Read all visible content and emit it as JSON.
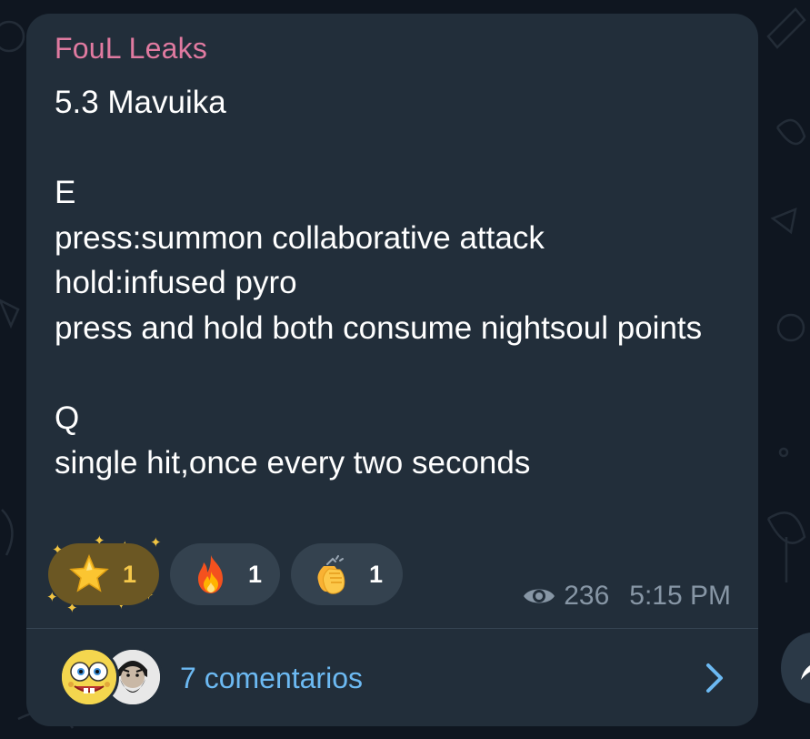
{
  "message": {
    "sender": "FouL Leaks",
    "text": "5.3 Mavuika\n\nE\npress:summon collaborative attack\nhold:infused pyro\npress and hold both consume nightsoul points\n\nQ\nsingle hit,once every two seconds",
    "views": "236",
    "time": "5:15 PM"
  },
  "reactions": [
    {
      "icon": "star-emoji",
      "count": "1",
      "selected": true
    },
    {
      "icon": "fire-emoji",
      "count": "1",
      "selected": false
    },
    {
      "icon": "clapping-hands-emoji",
      "count": "1",
      "selected": false
    }
  ],
  "comments": {
    "label": "7 comentarios",
    "avatars": [
      "spongebob-avatar",
      "bearded-man-avatar"
    ]
  },
  "colors": {
    "background": "#0f1620",
    "bubble": "#222e3a",
    "sender": "#e07aa0",
    "link": "#6cb9f2",
    "meta": "#8796a5",
    "selected_reaction": "#6b5723"
  }
}
